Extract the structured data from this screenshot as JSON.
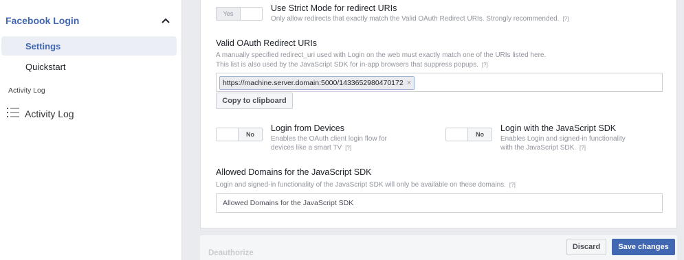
{
  "sidebar": {
    "section_title": "Facebook Login",
    "items": [
      {
        "label": "Settings",
        "active": true
      },
      {
        "label": "Quickstart",
        "active": false
      }
    ],
    "activity_section_label": "Activity Log",
    "activity_item_label": "Activity Log",
    "icons": {
      "collapse": "chevron-up-icon",
      "activity": "list-icon"
    }
  },
  "settings": {
    "strict_mode": {
      "toggle_label": "Yes",
      "title": "Use Strict Mode for redirect URIs",
      "description": "Only allow redirects that exactly match the Valid OAuth Redirect URIs. Strongly recommended.",
      "help": "[?]"
    },
    "redirect_uris": {
      "title": "Valid OAuth Redirect URIs",
      "description_line1": "A manually specified redirect_uri used with Login on the web must exactly match one of the URIs listed here.",
      "description_line2": "This list is also used by the JavaScript SDK for in-app browsers that suppress popups.",
      "help": "[?]",
      "uris": [
        "https://machine.server.domain:5000/1433652980470172"
      ],
      "remove_symbol": "×",
      "copy_button": "Copy to clipboard"
    },
    "login_devices": {
      "toggle_label": "No",
      "title": "Login from Devices",
      "description_line1": "Enables the OAuth client login flow for",
      "description_line2": "devices like a smart TV",
      "help": "[?]"
    },
    "login_js_sdk": {
      "toggle_label": "No",
      "title": "Login with the JavaScript SDK",
      "description_line1": "Enables Login and signed-in functionality",
      "description_line2": "with the JavaScript SDK.",
      "help": "[?]"
    },
    "allowed_domains": {
      "title": "Allowed Domains for the JavaScript SDK",
      "description": "Login and signed-in functionality of the JavaScript SDK will only be available on these domains.",
      "help": "[?]",
      "value": "",
      "placeholder": "Allowed Domains for the JavaScript SDK"
    }
  },
  "footer": {
    "deauthorize_label": "Deauthorize",
    "discard_button": "Discard",
    "save_button": "Save changes"
  },
  "colors": {
    "accent": "#4267b2",
    "background": "#e9ebee",
    "muted_text": "#90949c"
  }
}
